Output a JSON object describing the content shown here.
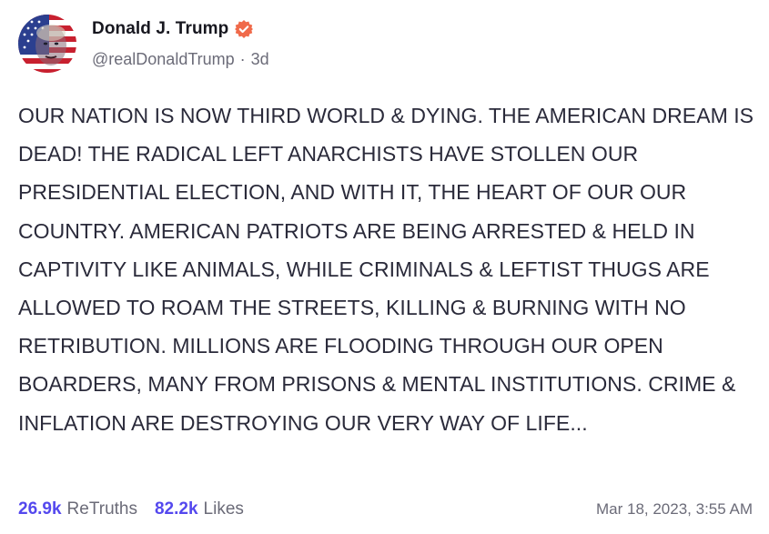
{
  "post": {
    "author": {
      "display_name": "Donald J. Trump",
      "handle": "@realDonaldTrump",
      "separator": "·",
      "age": "3d",
      "verified_icon": "verified-badge-icon",
      "avatar_icon": "avatar-flag-portrait"
    },
    "text": "OUR NATION IS NOW THIRD WORLD & DYING. THE AMERICAN DREAM IS DEAD! THE RADICAL LEFT ANARCHISTS HAVE STOLLEN  OUR PRESIDENTIAL ELECTION, AND WITH IT, THE HEART OF OUR OUR COUNTRY. AMERICAN PATRIOTS ARE BEING ARRESTED & HELD IN CAPTIVITY LIKE ANIMALS, WHILE CRIMINALS & LEFTIST THUGS ARE ALLOWED TO ROAM THE STREETS, KILLING & BURNING WITH NO RETRIBUTION. MILLIONS ARE FLOODING THROUGH OUR OPEN BOARDERS, MANY FROM PRISONS & MENTAL INSTITUTIONS. CRIME & INFLATION ARE DESTROYING OUR VERY WAY OF LIFE...",
    "stats": {
      "retruths_count": "26.9k",
      "retruths_label": "ReTruths",
      "likes_count": "82.2k",
      "likes_label": "Likes"
    },
    "timestamp": "Mar 18, 2023, 3:55 AM"
  },
  "colors": {
    "accent": "#5448ee",
    "verified_badge": "#f06a4a",
    "muted_text": "#6b6b78",
    "body_text": "#2a2a3a"
  }
}
